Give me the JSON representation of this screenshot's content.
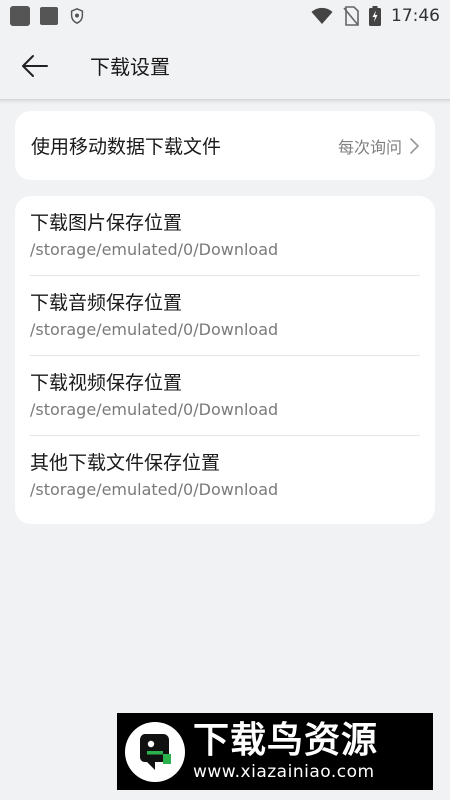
{
  "status_bar": {
    "time": "17:46",
    "icons": [
      "app-square-icon",
      "app-square-icon",
      "shield-icon",
      "wifi-icon",
      "no-sim-icon",
      "battery-charging-icon"
    ]
  },
  "toolbar": {
    "title": "下载设置",
    "back_icon": "arrow-left-icon"
  },
  "mobile_data": {
    "label": "使用移动数据下载文件",
    "value": "每次询问"
  },
  "paths": [
    {
      "title": "下载图片保存位置",
      "path": "/storage/emulated/0/Download"
    },
    {
      "title": "下载音频保存位置",
      "path": "/storage/emulated/0/Download"
    },
    {
      "title": "下载视频保存位置",
      "path": "/storage/emulated/0/Download"
    },
    {
      "title": "其他下载文件保存位置",
      "path": "/storage/emulated/0/Download"
    }
  ],
  "watermark": {
    "brand": "下载鸟资源",
    "url": "www.xiazainiao.com"
  },
  "colors": {
    "background": "#f1f2f4",
    "card": "#ffffff",
    "secondary_text": "#808080"
  }
}
